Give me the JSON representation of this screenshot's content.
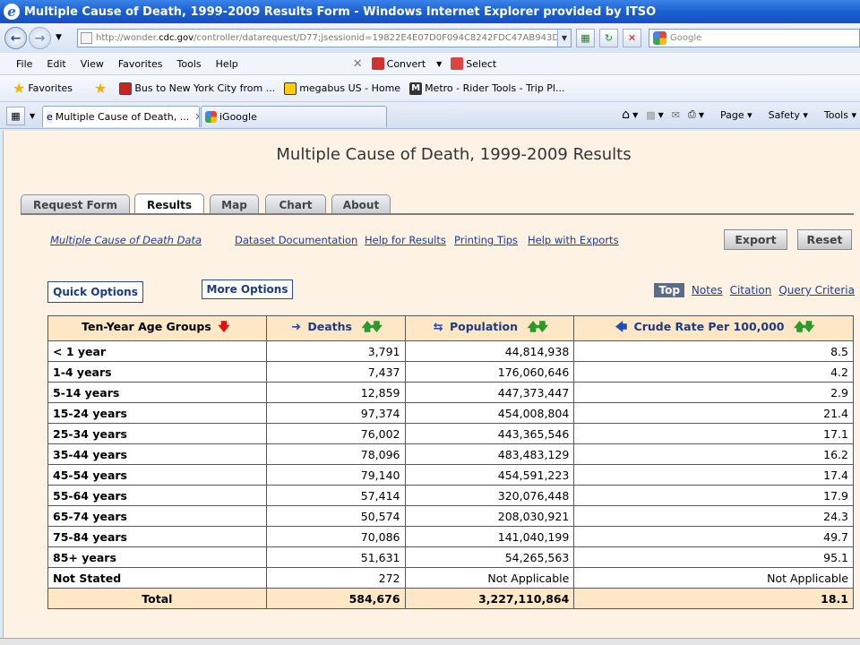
{
  "window": {
    "title": "Multiple Cause of Death, 1999-2009 Results Form - Windows Internet Explorer provided by ITSO"
  },
  "address": {
    "url_prefix": "http://wonder.",
    "url_host": "cdc.gov",
    "url_rest": "/controller/datarequest/D77;jsessionid=19822E4E07D0F094C8242FDC47AB943D",
    "search_placeholder": "Google"
  },
  "menu": {
    "items": [
      "File",
      "Edit",
      "View",
      "Favorites",
      "Tools",
      "Help"
    ],
    "convert": "Convert",
    "select": "Select"
  },
  "favorites": {
    "label": "Favorites",
    "items": [
      "Bus to New York City from ...",
      "megabus US - Home",
      "Metro - Rider Tools - Trip Pl..."
    ]
  },
  "browser_tabs": [
    "Multiple Cause of Death, ...",
    "iGoogle"
  ],
  "commandbar": {
    "page": "Page",
    "safety": "Safety",
    "tools": "Tools"
  },
  "page": {
    "title": "Multiple Cause of Death, 1999-2009 Results",
    "tabs": [
      "Request Form",
      "Results",
      "Map",
      "Chart",
      "About"
    ],
    "active_tab": "Results",
    "links": [
      "Multiple Cause of Death Data",
      "Dataset Documentation",
      "Help for Results",
      "Printing Tips",
      "Help with Exports"
    ],
    "buttons": {
      "export": "Export",
      "reset": "Reset"
    },
    "quick_options": "Quick Options",
    "more_options": "More Options",
    "right_links": {
      "top": "Top",
      "notes": "Notes",
      "citation": "Citation",
      "query_criteria": "Query Criteria"
    },
    "table": {
      "headers": [
        "Ten-Year Age Groups",
        "Deaths",
        "Population",
        "Crude Rate Per 100,000"
      ],
      "rows": [
        [
          "< 1 year",
          "3,791",
          "44,814,938",
          "8.5"
        ],
        [
          "1-4 years",
          "7,437",
          "176,060,646",
          "4.2"
        ],
        [
          "5-14 years",
          "12,859",
          "447,373,447",
          "2.9"
        ],
        [
          "15-24 years",
          "97,374",
          "454,008,804",
          "21.4"
        ],
        [
          "25-34 years",
          "76,002",
          "443,365,546",
          "17.1"
        ],
        [
          "35-44 years",
          "78,096",
          "483,483,129",
          "16.2"
        ],
        [
          "45-54 years",
          "79,140",
          "454,591,223",
          "17.4"
        ],
        [
          "55-64 years",
          "57,414",
          "320,076,448",
          "17.9"
        ],
        [
          "65-74 years",
          "50,574",
          "208,030,921",
          "24.3"
        ],
        [
          "75-84 years",
          "70,086",
          "141,040,199",
          "49.7"
        ],
        [
          "85+ years",
          "51,631",
          "54,265,563",
          "95.1"
        ],
        [
          "Not Stated",
          "272",
          "Not Applicable",
          "Not Applicable"
        ]
      ],
      "total": [
        "Total",
        "584,676",
        "3,227,110,864",
        "18.1"
      ]
    }
  }
}
